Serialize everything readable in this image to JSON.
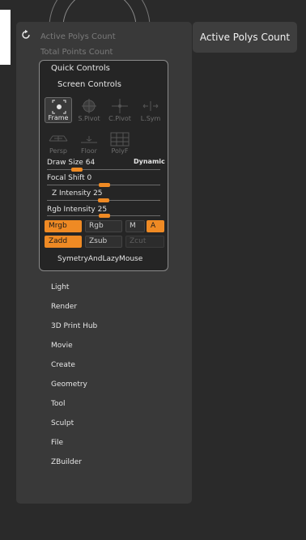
{
  "background": {
    "color": "#2a2a2a"
  },
  "header": {
    "stat1": "Active Polys Count",
    "stat2": "Total Points Count",
    "refresh_icon": "refresh-icon"
  },
  "tooltip": {
    "text": "Active Polys Count"
  },
  "quick_controls": {
    "title": "Quick Controls",
    "screen_controls": "Screen Controls",
    "icons": [
      {
        "label": "Frame",
        "icon": "frame-icon",
        "active": true
      },
      {
        "label": "S.Pivot",
        "icon": "sphere-pivot-icon",
        "active": false
      },
      {
        "label": "C.Pivot",
        "icon": "crosshair-pivot-icon",
        "active": false
      },
      {
        "label": "L.Sym",
        "icon": "local-symmetry-icon",
        "active": false
      },
      {
        "label": "Persp",
        "icon": "perspective-icon",
        "active": false
      },
      {
        "label": "Floor",
        "icon": "floor-icon",
        "active": false
      },
      {
        "label": "PolyF",
        "icon": "polyframe-icon",
        "active": false
      }
    ],
    "sliders": {
      "draw_size": {
        "label": "Draw Size",
        "value": "64"
      },
      "focal_shift": {
        "label": "Focal Shift",
        "value": "0"
      },
      "z_intensity": {
        "label": "Z Intensity",
        "value": "25"
      },
      "rgb_intensity": {
        "label": "Rgb Intensity",
        "value": "25"
      }
    },
    "dynamic": "Dynamic",
    "buttons": {
      "mrgb": "Mrgb",
      "rgb": "Rgb",
      "m": "M",
      "a": "A",
      "zadd": "Zadd",
      "zsub": "Zsub",
      "zcut": "Zcut"
    },
    "symmetry": "SymetryAndLazyMouse"
  },
  "menu": [
    "Light",
    "Render",
    "3D Print Hub",
    "Movie",
    "Create",
    "Geometry",
    "Tool",
    "Sculpt",
    "File",
    "ZBuilder"
  ],
  "colors": {
    "accent": "#ef8a24",
    "panel": "#393939",
    "box": "#252525"
  }
}
